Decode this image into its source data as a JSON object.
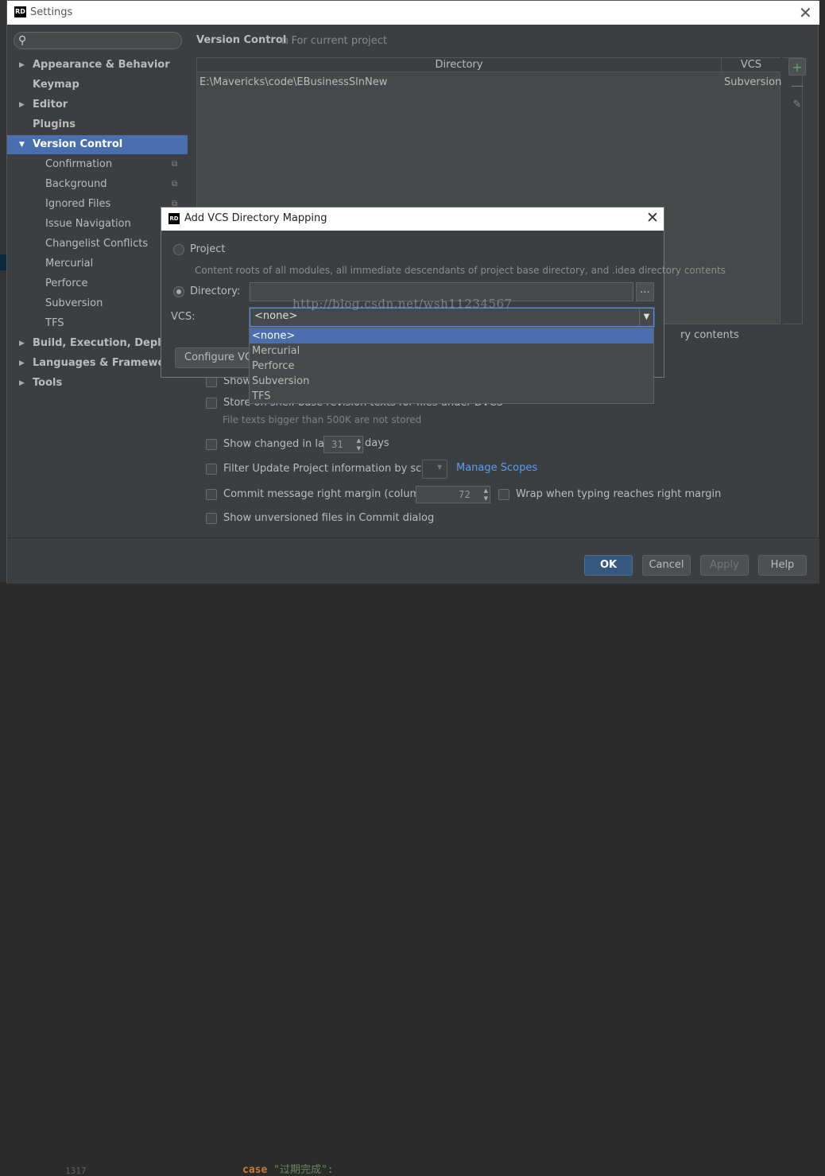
{
  "window": {
    "title": "Settings",
    "app_icon": "RD"
  },
  "search": {
    "placeholder": ""
  },
  "tree": {
    "items": [
      {
        "label": "Appearance & Behavior",
        "level": 0,
        "bold": true,
        "expandable": true,
        "expanded": false
      },
      {
        "label": "Keymap",
        "level": 0,
        "bold": true
      },
      {
        "label": "Editor",
        "level": 0,
        "bold": true,
        "expandable": true,
        "expanded": false
      },
      {
        "label": "Plugins",
        "level": 0,
        "bold": true
      },
      {
        "label": "Version Control",
        "level": 0,
        "bold": true,
        "expandable": true,
        "expanded": true,
        "selected": true
      },
      {
        "label": "Confirmation",
        "level": 1,
        "project_icon": true
      },
      {
        "label": "Background",
        "level": 1,
        "project_icon": true
      },
      {
        "label": "Ignored Files",
        "level": 1,
        "project_icon": true
      },
      {
        "label": "Issue Navigation",
        "level": 1
      },
      {
        "label": "Changelist Conflicts",
        "level": 1
      },
      {
        "label": "Mercurial",
        "level": 1
      },
      {
        "label": "Perforce",
        "level": 1
      },
      {
        "label": "Subversion",
        "level": 1
      },
      {
        "label": "TFS",
        "level": 1
      },
      {
        "label": "Build, Execution, Deployment",
        "level": 0,
        "bold": true,
        "expandable": true,
        "expanded": false
      },
      {
        "label": "Languages & Frameworks",
        "level": 0,
        "bold": true,
        "expandable": true,
        "expanded": false
      },
      {
        "label": "Tools",
        "level": 0,
        "bold": true,
        "expandable": true,
        "expanded": false
      }
    ]
  },
  "content": {
    "title": "Version Control",
    "scope_note": "For current project",
    "table": {
      "columns": [
        "Directory",
        "VCS"
      ],
      "rows": [
        {
          "directory": "E:\\Mavericks\\code\\EBusinessSlnNew",
          "vcs": "Subversion"
        }
      ]
    },
    "partial_text": "ry contents",
    "options": {
      "show_partial": "Show c",
      "store_base": "Store on shelf base revision texts for files under DVCS",
      "store_hint": "File texts bigger than 500K are not stored",
      "show_changed_prefix": "Show changed in last",
      "show_changed_value": "31",
      "show_changed_suffix": "days",
      "filter_update": "Filter Update Project information by scope",
      "manage_scopes": "Manage Scopes",
      "commit_margin": "Commit message right margin (columns):",
      "commit_margin_value": "72",
      "wrap_typing": "Wrap when typing reaches right margin",
      "show_unversioned": "Show unversioned files in Commit dialog"
    }
  },
  "footer": {
    "ok": "OK",
    "cancel": "Cancel",
    "apply": "Apply",
    "help": "Help"
  },
  "dialog": {
    "title": "Add VCS Directory Mapping",
    "project_label": "Project",
    "project_hint": "Content roots of all modules, all immediate descendants of project base directory, and .idea directory contents",
    "directory_label": "Directory:",
    "directory_value": "",
    "browse_label": "...",
    "vcs_label": "VCS:",
    "vcs_selected": "<none>",
    "configure_label": "Configure VCS",
    "vcs_options": [
      "<none>",
      "Mercurial",
      "Perforce",
      "Subversion",
      "TFS"
    ]
  },
  "watermark": "http://blog.csdn.net/wsh11234567",
  "background": {
    "line_number": "1317",
    "code_keyword": "case",
    "code_string": "\"过期完成\":"
  }
}
